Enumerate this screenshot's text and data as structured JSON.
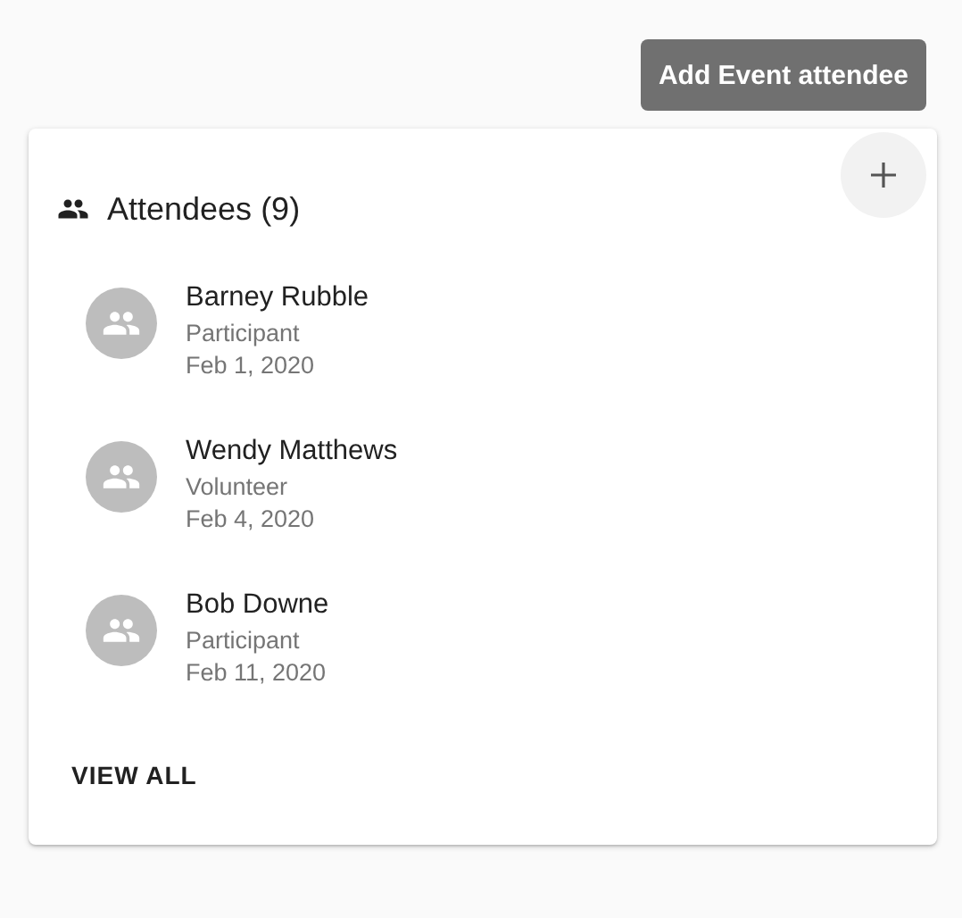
{
  "add_button": {
    "label": "Add Event attendee"
  },
  "card": {
    "title": "Attendees (9)",
    "attendees": [
      {
        "name": "Barney Rubble",
        "role": "Participant",
        "date": "Feb 1, 2020"
      },
      {
        "name": "Wendy Matthews",
        "role": "Volunteer",
        "date": "Feb 4, 2020"
      },
      {
        "name": "Bob Downe",
        "role": "Participant",
        "date": "Feb 11, 2020"
      }
    ],
    "view_all": "VIEW ALL"
  }
}
